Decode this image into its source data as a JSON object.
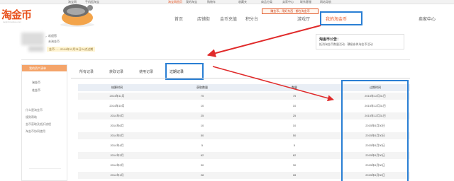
{
  "topbar": {
    "items": [
      "淘宝网",
      "手机逛淘宝",
      "淘宝网首页",
      "我的淘宝",
      "购物车",
      "收藏夹",
      "商品分类",
      "卖家中心",
      "联系客服",
      "网站导航"
    ]
  },
  "logo": {
    "title": "淘金币",
    "subtitle": "taojinbi.taobao.com"
  },
  "promo": {
    "text": "赚金币，用好东西 · 都在淘金币"
  },
  "nav": {
    "items": [
      "首页",
      "店铺街",
      "金币充值",
      "积分台",
      "游戏厅",
      "我的淘金币"
    ],
    "user_center": "卖家中心"
  },
  "user": {
    "welcome": "，欢迎您",
    "status": "未淘金币",
    "expire_note": "金币……2014年12月31日24点过期"
  },
  "notice": {
    "title": "淘金币公告：",
    "body": "抵消淘金币数量活动 · 積極参與淘金币活动"
  },
  "sidebar": {
    "header": "我的资产清单",
    "items": [
      "淘金币",
      "花金币"
    ],
    "help": [
      "什么是淘金币",
      "规则帮助",
      "金币获取及抵扣流程",
      "淘金币协同使用"
    ]
  },
  "tabs": [
    "所有记录",
    "获取记录",
    "使用记录",
    "过期记录"
  ],
  "table": {
    "headers": [
      "结算时间",
      "获取数量",
      "数量",
      "过期时间"
    ],
    "rows": [
      [
        "2014年11月",
        "75",
        "75",
        "2015年12月31日"
      ],
      [
        "2014年10月",
        "10",
        "10",
        "2015年12月31日"
      ],
      [
        "2014年9月",
        "25",
        "25",
        "2015年12月31日"
      ],
      [
        "2014年6月",
        "10",
        "10",
        "2015年6月30日"
      ],
      [
        "2014年5月",
        "50",
        "50",
        "2015年6月30日"
      ],
      [
        "2014年4月",
        "5",
        "5",
        "2015年6月30日"
      ],
      [
        "2014年3月",
        "62",
        "62",
        "2015年6月30日"
      ],
      [
        "2014年2月",
        "30",
        "30",
        "2015年6月30日"
      ],
      [
        "2014年1月",
        "28",
        "28",
        "2015年6月30日"
      ]
    ]
  },
  "colors": {
    "brand": "#e8501b",
    "highlight": "#2a7fd4",
    "arrow": "#e02a2a",
    "sidebar_header": "#f4a46a"
  }
}
